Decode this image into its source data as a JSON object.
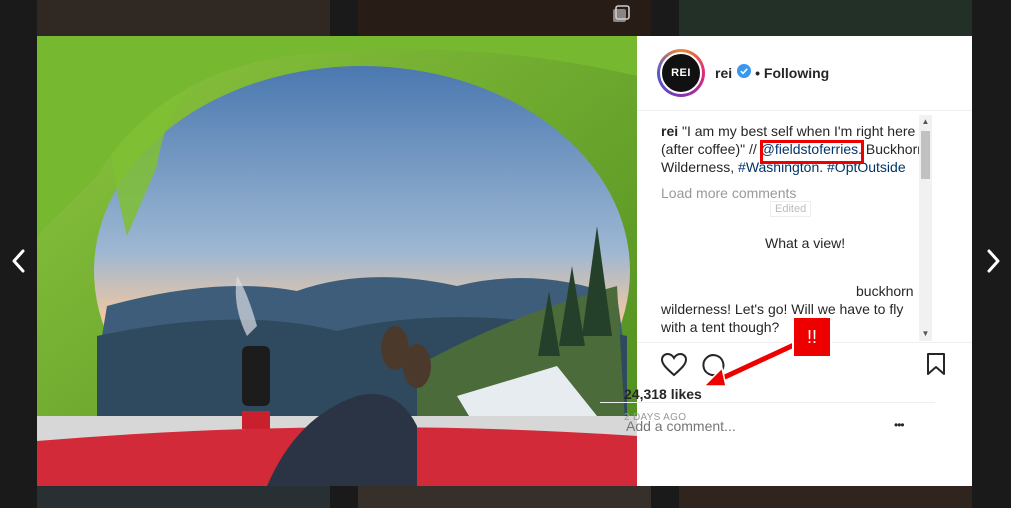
{
  "post": {
    "username": "rei",
    "follow_status": "• Following",
    "avatar_text": "REI",
    "caption_user": "rei",
    "caption_text_1": "\"I am my best self when I'm right here (after coffee)\" // ",
    "caption_mention": "@fieldstoferries",
    "caption_text_2": ". Buckhorn Wilderness, ",
    "hashtag_1": "#Washington",
    "caption_text_3": ". ",
    "hashtag_2": "#OptOutside",
    "load_more": "Load more comments",
    "edited": "Edited",
    "comment_1": "What a view!",
    "comment_2_frag": "buckhorn",
    "comment_2_line2": "wilderness! Let's go! Will we have to fly",
    "comment_2_line3": "with a tent though?",
    "likes": "24,318 likes",
    "date": "2 DAYS AGO",
    "add_comment_placeholder": "Add a comment...",
    "more_options": "•••"
  },
  "annotation": {
    "badge_text": "!!"
  },
  "colors": {
    "accent_red": "#e00000",
    "link": "#003569",
    "verified": "#3897f0"
  }
}
